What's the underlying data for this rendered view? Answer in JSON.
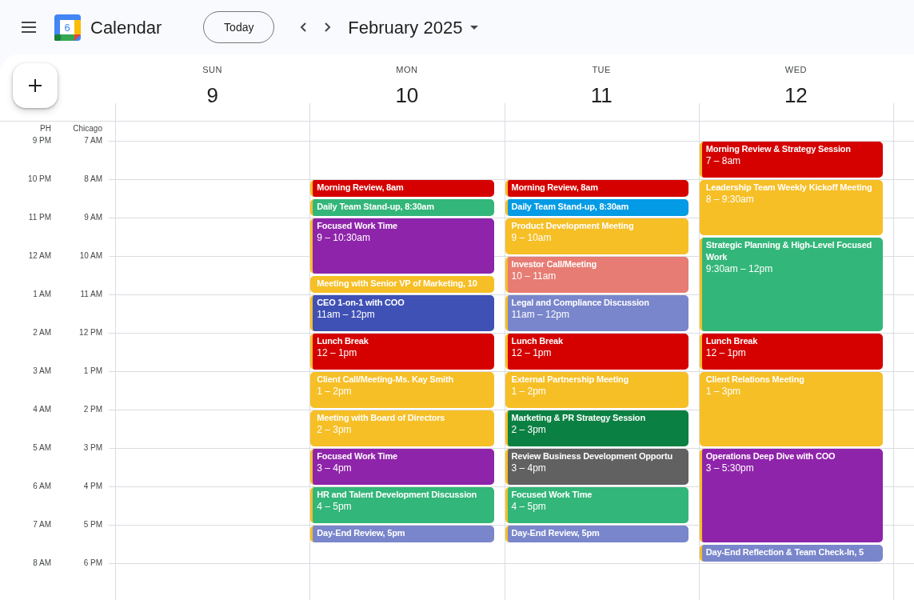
{
  "app": {
    "title": "Calendar",
    "logo_digit": "6"
  },
  "toolbar": {
    "today": "Today",
    "period": "February 2025"
  },
  "timezones": [
    "PH",
    "Chicago"
  ],
  "hours": [
    {
      "ph": "9 PM",
      "chicago": "7 AM"
    },
    {
      "ph": "10 PM",
      "chicago": "8 AM"
    },
    {
      "ph": "11 PM",
      "chicago": "9 AM"
    },
    {
      "ph": "12 AM",
      "chicago": "10 AM"
    },
    {
      "ph": "1 AM",
      "chicago": "11 AM"
    },
    {
      "ph": "2 AM",
      "chicago": "12 PM"
    },
    {
      "ph": "3 AM",
      "chicago": "1 PM"
    },
    {
      "ph": "4 AM",
      "chicago": "2 PM"
    },
    {
      "ph": "5 AM",
      "chicago": "3 PM"
    },
    {
      "ph": "6 AM",
      "chicago": "4 PM"
    },
    {
      "ph": "7 AM",
      "chicago": "5 PM"
    },
    {
      "ph": "8 AM",
      "chicago": "6 PM"
    }
  ],
  "days": [
    {
      "weekday": "SUN",
      "date": "9"
    },
    {
      "weekday": "MON",
      "date": "10",
      "events": [
        {
          "title": "Morning Review, 8am",
          "color": "#d50000"
        },
        {
          "title": "Daily Team Stand-up, 8:30am",
          "color": "#33b679"
        },
        {
          "title": "Focused Work Time",
          "time": "9 – 10:30am",
          "color": "#8e24aa"
        },
        {
          "title": "Meeting with Senior VP of Marketing, 10",
          "color": "#f6bf26"
        },
        {
          "title": "CEO 1-on-1 with COO",
          "time": "11am – 12pm",
          "color": "#3f51b5"
        },
        {
          "title": "Lunch Break",
          "time": "12 – 1pm",
          "color": "#d50000"
        },
        {
          "title": "Client Call/Meeting-Ms. Kay Smith",
          "time": "1 – 2pm",
          "color": "#f6bf26"
        },
        {
          "title": "Meeting with Board of Directors",
          "time": "2 – 3pm",
          "color": "#f6bf26"
        },
        {
          "title": "Focused Work Time",
          "time": "3 – 4pm",
          "color": "#8e24aa"
        },
        {
          "title": "HR and Talent Development Discussion",
          "time": "4 – 5pm",
          "color": "#33b679"
        },
        {
          "title": "Day-End Review, 5pm",
          "color": "#7986cb"
        }
      ]
    },
    {
      "weekday": "TUE",
      "date": "11",
      "events": [
        {
          "title": "Morning Review, 8am",
          "color": "#d50000"
        },
        {
          "title": "Daily Team Stand-up, 8:30am",
          "color": "#039be5"
        },
        {
          "title": "Product Development Meeting",
          "time": "9 – 10am",
          "color": "#f6bf26"
        },
        {
          "title": "Investor Call/Meeting",
          "time": "10 – 11am",
          "color": "#e67c73"
        },
        {
          "title": "Legal and Compliance Discussion",
          "time": "11am – 12pm",
          "color": "#7986cb"
        },
        {
          "title": "Lunch Break",
          "time": "12 – 1pm",
          "color": "#d50000"
        },
        {
          "title": "External Partnership Meeting",
          "time": "1 – 2pm",
          "color": "#f6bf26"
        },
        {
          "title": "Marketing & PR Strategy Session",
          "time": "2 – 3pm",
          "color": "#0b8043"
        },
        {
          "title": "Review Business Development Opportu",
          "time": "3 – 4pm",
          "color": "#616161"
        },
        {
          "title": "Focused Work Time",
          "time": "4 – 5pm",
          "color": "#33b679"
        },
        {
          "title": "Day-End Review, 5pm",
          "color": "#7986cb"
        }
      ]
    },
    {
      "weekday": "WED",
      "date": "12",
      "events": [
        {
          "title": "Morning Review & Strategy Session",
          "time": "7 – 8am",
          "color": "#d50000"
        },
        {
          "title": "Leadership Team Weekly Kickoff Meeting",
          "time": "8 – 9:30am",
          "color": "#f6bf26"
        },
        {
          "title": "Strategic Planning & High-Level Focused Work",
          "time": "9:30am – 12pm",
          "color": "#33b679"
        },
        {
          "title": "Lunch Break",
          "time": "12 – 1pm",
          "color": "#d50000"
        },
        {
          "title": "Client Relations Meeting",
          "time": "1 – 3pm",
          "color": "#f6bf26"
        },
        {
          "title": "Operations Deep Dive with COO",
          "time": "3 – 5:30pm",
          "color": "#8e24aa"
        },
        {
          "title": "Day-End Reflection & Team Check-In, 5",
          "color": "#7986cb"
        }
      ]
    }
  ]
}
